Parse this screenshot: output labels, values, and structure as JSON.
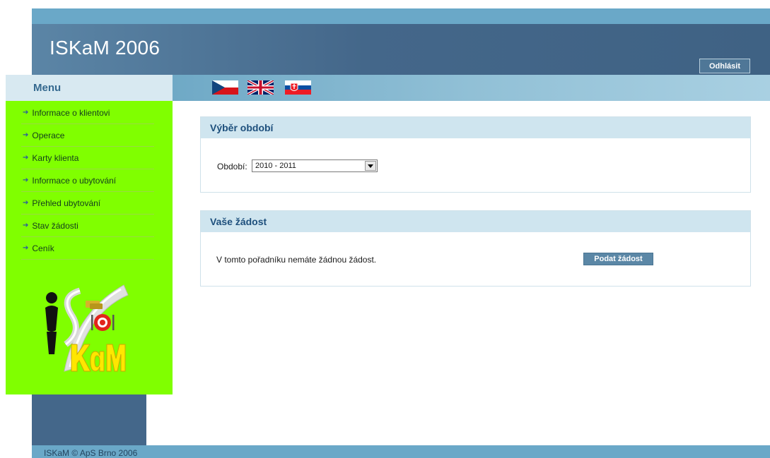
{
  "header": {
    "app_title": "ISKaM 2006",
    "logout_label": "Odhlásit"
  },
  "sidebar": {
    "menu_title": "Menu",
    "items": [
      {
        "label": "Informace o klientovi"
      },
      {
        "label": "Operace"
      },
      {
        "label": "Karty klienta"
      },
      {
        "label": "Informace o ubytování"
      },
      {
        "label": "Přehled ubytování"
      },
      {
        "label": "Stav žádosti"
      },
      {
        "label": "Ceník"
      }
    ],
    "logo_icon": "iskam-logo"
  },
  "languages": [
    {
      "icon": "czech-flag-icon"
    },
    {
      "icon": "uk-flag-icon"
    },
    {
      "icon": "slovak-flag-icon"
    }
  ],
  "period_panel": {
    "title": "Výběr období",
    "field_label": "Období:",
    "selected_value": "2010 - 2011"
  },
  "request_panel": {
    "title": "Vaše žádost",
    "message": "V tomto pořadníku nemáte žádnou žádost.",
    "submit_label": "Podat žádost"
  },
  "footer": {
    "text": "ISKaM © ApS Brno 2006"
  },
  "colors": {
    "header_blue": "#44678a",
    "strip_blue": "#6aa8c8",
    "sidebar_green": "#80ff00",
    "panel_head": "#cfe5ef",
    "title_blue": "#1d4f7c"
  }
}
